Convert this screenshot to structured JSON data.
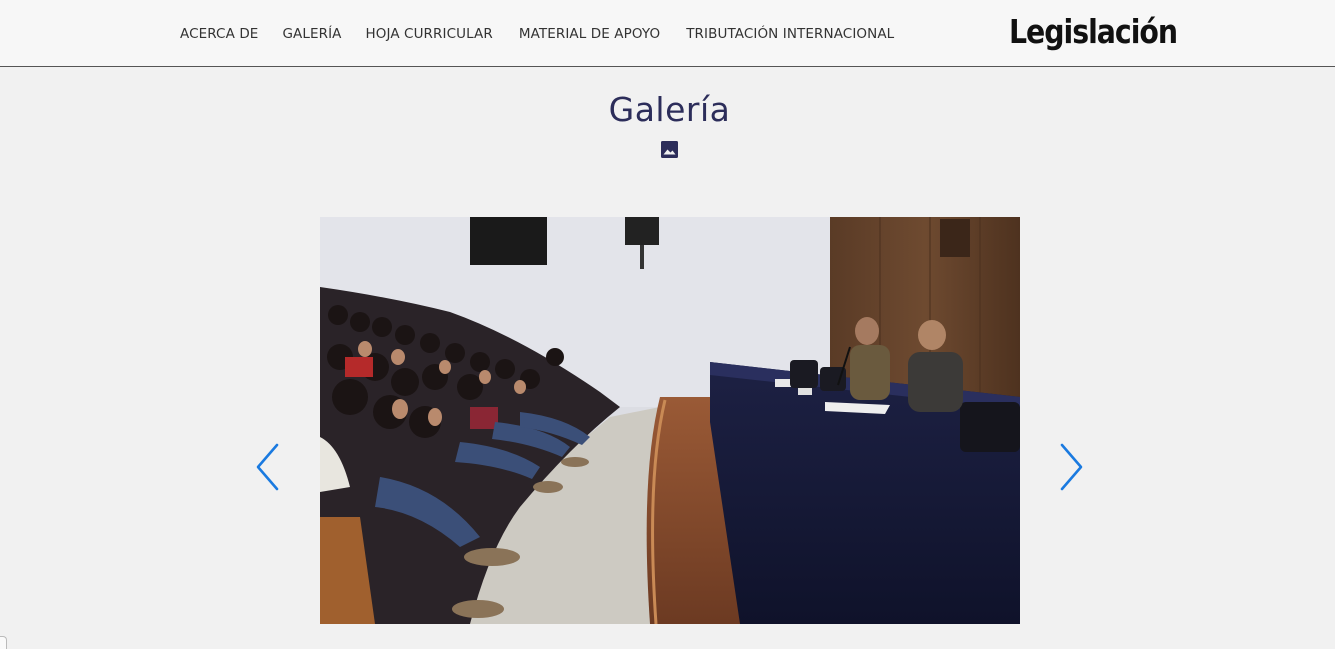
{
  "nav": {
    "items": [
      {
        "label": "ACERCA DE"
      },
      {
        "label": "GALERÍA"
      },
      {
        "label": "HOJA CURRICULAR"
      },
      {
        "label": "MATERIAL DE APOYO"
      },
      {
        "label": "TRIBUTACIÓN INTERNACIONAL"
      }
    ]
  },
  "brand": {
    "title": "Legislación"
  },
  "gallery": {
    "title": "Galería",
    "title_icon": "image-icon",
    "prev_icon": "chevron-left-icon",
    "next_icon": "chevron-right-icon"
  },
  "colors": {
    "title": "#2c2d5a",
    "arrow": "#1a7ae0",
    "page_background": "#f1f1f1",
    "navbar_background": "#f7f7f7"
  }
}
